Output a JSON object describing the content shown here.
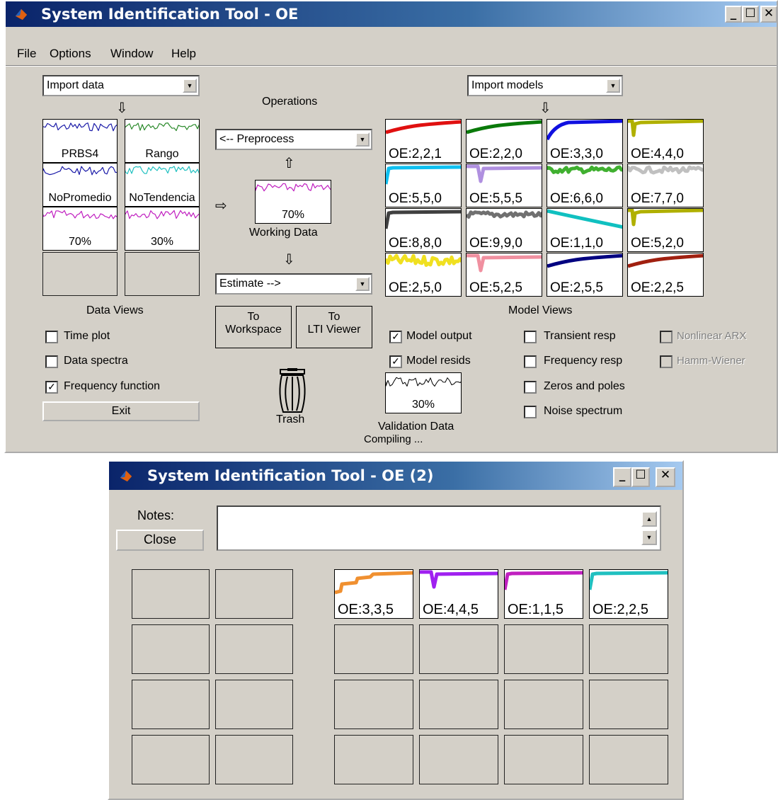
{
  "main": {
    "title": "System Identification Tool - OE",
    "menu": [
      "File",
      "Options",
      "Window",
      "Help"
    ],
    "import_data": "Import data",
    "import_models": "Import models",
    "operations_label": "Operations",
    "preprocess": "<-- Preprocess",
    "estimate": "Estimate -->",
    "data_tiles": [
      {
        "label": "PRBS4",
        "color": "#1a1aa8"
      },
      {
        "label": "Rango",
        "color": "#2a8a2a"
      },
      {
        "label": "NoPromedio",
        "color": "#1a1aa8"
      },
      {
        "label": "NoTendencia",
        "color": "#20c0c0"
      },
      {
        "label": "70%",
        "color": "#c020c0"
      },
      {
        "label": "30%",
        "color": "#c020c0"
      }
    ],
    "working_data": {
      "tile_label": "70%",
      "caption": "Working Data",
      "color": "#c020c0"
    },
    "to_workspace": {
      "line1": "To",
      "line2": "Workspace"
    },
    "to_lti": {
      "line1": "To",
      "line2": "LTI Viewer"
    },
    "data_views_label": "Data Views",
    "data_views": [
      {
        "label": "Time plot",
        "checked": false
      },
      {
        "label": "Data spectra",
        "checked": false
      },
      {
        "label": "Frequency function",
        "checked": true
      }
    ],
    "exit": "Exit",
    "trash": "Trash",
    "model_views_label": "Model Views",
    "model_output": {
      "label": "Model output",
      "checked": true
    },
    "model_resids": {
      "label": "Model resids",
      "checked": true
    },
    "model_views": [
      {
        "label": "Transient resp",
        "checked": false
      },
      {
        "label": "Frequency resp",
        "checked": false
      },
      {
        "label": "Zeros and poles",
        "checked": false
      },
      {
        "label": "Noise spectrum",
        "checked": false
      }
    ],
    "disabled_views": [
      {
        "label": "Nonlinear ARX",
        "checked": false
      },
      {
        "label": "Hamm-Wiener",
        "checked": false
      }
    ],
    "validation": {
      "tile_label": "30%",
      "caption": "Validation Data",
      "status": "Compiling ..."
    },
    "model_tiles": [
      {
        "label": "OE:2,2,1",
        "color": "#e01010",
        "shape": "rise"
      },
      {
        "label": "OE:2,2,0",
        "color": "#0a7a0a",
        "shape": "rise"
      },
      {
        "label": "OE:3,3,0",
        "color": "#1010e0",
        "shape": "curve"
      },
      {
        "label": "OE:4,4,0",
        "color": "#b0b000",
        "shape": "spike"
      },
      {
        "label": "OE:5,5,0",
        "color": "#10c0f0",
        "shape": "step"
      },
      {
        "label": "OE:5,5,5",
        "color": "#b090e0",
        "shape": "dip"
      },
      {
        "label": "OE:6,6,0",
        "color": "#40b030",
        "shape": "noisy"
      },
      {
        "label": "OE:7,7,0",
        "color": "#c0c0c0",
        "shape": "noisy"
      },
      {
        "label": "OE:8,8,0",
        "color": "#404040",
        "shape": "step"
      },
      {
        "label": "OE:9,9,0",
        "color": "#707070",
        "shape": "noisy"
      },
      {
        "label": "OE:1,1,0",
        "color": "#10c0c0",
        "shape": "fall"
      },
      {
        "label": "OE:5,2,0",
        "color": "#b0b000",
        "shape": "spike"
      },
      {
        "label": "OE:2,5,0",
        "color": "#f0e020",
        "shape": "wave"
      },
      {
        "label": "OE:5,2,5",
        "color": "#f090a0",
        "shape": "dip"
      },
      {
        "label": "OE:2,5,5",
        "color": "#000080",
        "shape": "rise"
      },
      {
        "label": "OE:2,2,5",
        "color": "#a02010",
        "shape": "rise"
      }
    ]
  },
  "second": {
    "title": "System Identification Tool - OE (2)",
    "notes_label": "Notes:",
    "close": "Close",
    "notes_value": "",
    "model_tiles": [
      {
        "label": "OE:3,3,5",
        "color": "#f09030",
        "shape": "stair"
      },
      {
        "label": "OE:4,4,5",
        "color": "#a020f0",
        "shape": "dip"
      },
      {
        "label": "OE:1,1,5",
        "color": "#c020c0",
        "shape": "step"
      },
      {
        "label": "OE:2,2,5",
        "color": "#20c0c0",
        "shape": "step"
      }
    ]
  }
}
